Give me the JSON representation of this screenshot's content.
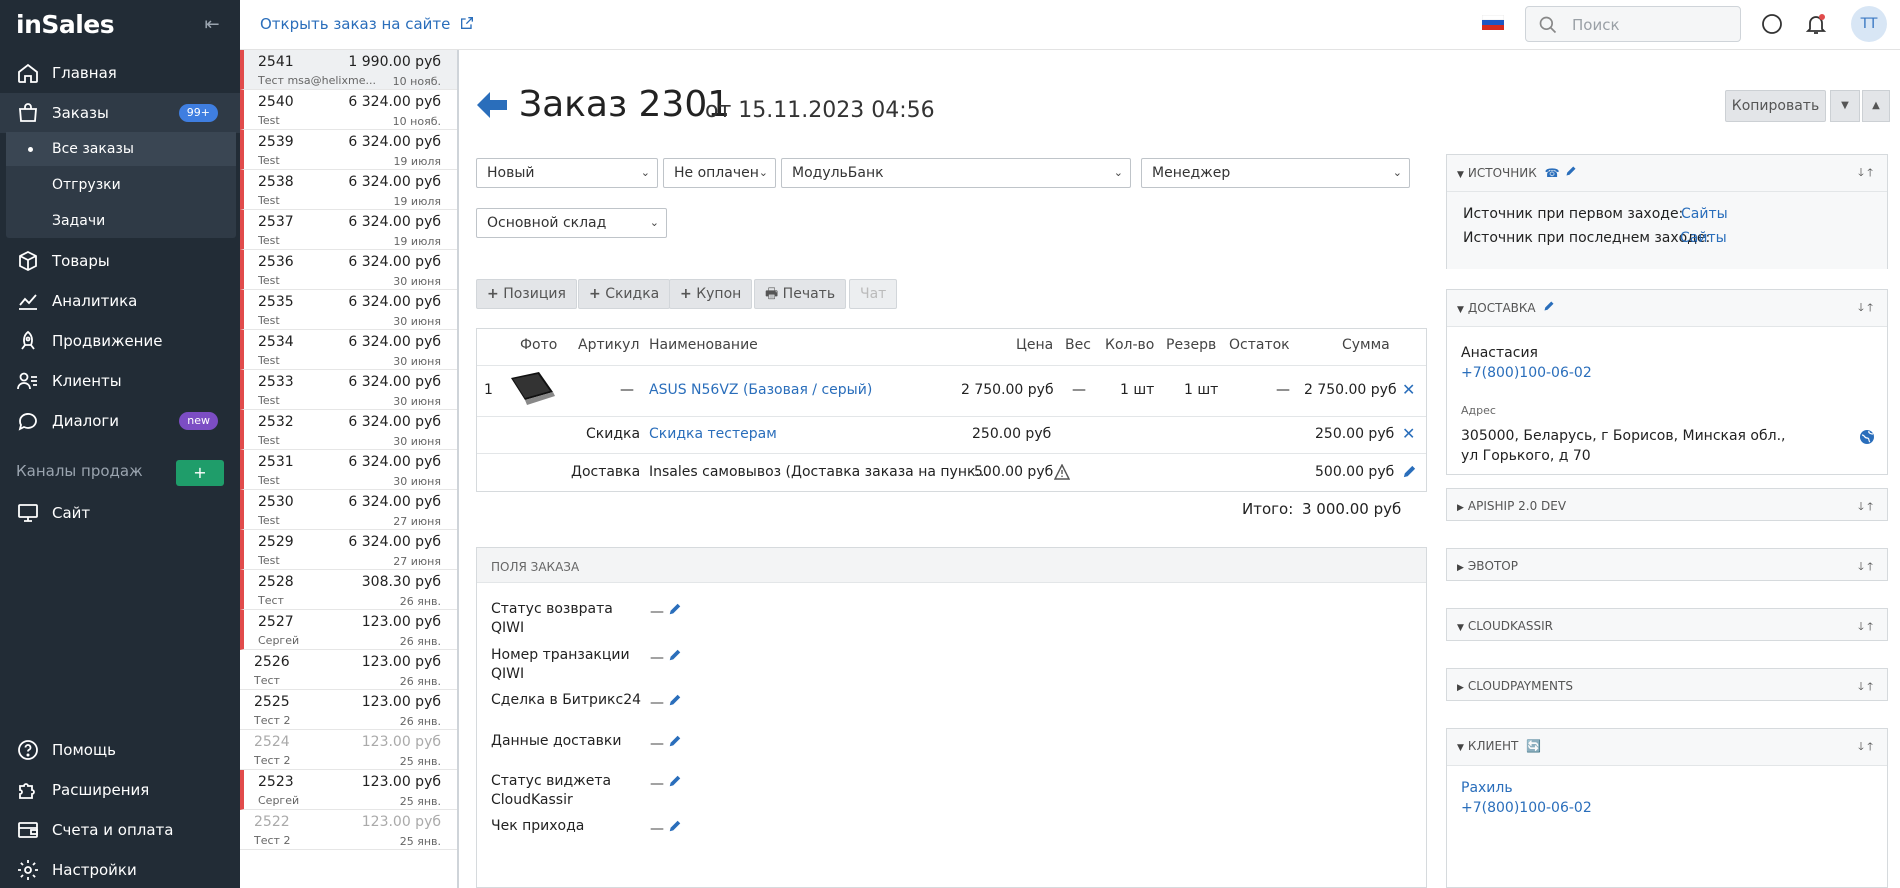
{
  "sidebar": {
    "logo": "inSales",
    "nav": [
      {
        "label": "Главная",
        "icon": "home-icon"
      },
      {
        "label": "Заказы",
        "icon": "bag-icon",
        "badge": "99+"
      },
      {
        "label": "Товары",
        "icon": "box-icon"
      },
      {
        "label": "Аналитика",
        "icon": "chart-icon"
      },
      {
        "label": "Продвижение",
        "icon": "rocket-icon"
      },
      {
        "label": "Клиенты",
        "icon": "users-icon"
      },
      {
        "label": "Диалоги",
        "icon": "chat-icon",
        "badge": "new"
      }
    ],
    "subnav": [
      "Все заказы",
      "Отгрузки",
      "Задачи"
    ],
    "channels_label": "Каналы продаж",
    "add_channel": "+",
    "site": "Сайт",
    "bottom": [
      "Помощь",
      "Расширения",
      "Счета и оплата",
      "Настройки"
    ]
  },
  "topbar": {
    "open_site": "Открыть заказ на сайте",
    "search_placeholder": "Поиск",
    "avatar": "TT"
  },
  "order_list": [
    {
      "num": "2541",
      "price": "1 990.00 руб",
      "who": "Тест msa@helixme...",
      "date": "10 нояб.",
      "red": true,
      "selected": true
    },
    {
      "num": "2540",
      "price": "6 324.00 руб",
      "who": "Test",
      "date": "10 нояб.",
      "red": true
    },
    {
      "num": "2539",
      "price": "6 324.00 руб",
      "who": "Test",
      "date": "19 июля",
      "red": true
    },
    {
      "num": "2538",
      "price": "6 324.00 руб",
      "who": "Test",
      "date": "19 июля",
      "red": true
    },
    {
      "num": "2537",
      "price": "6 324.00 руб",
      "who": "Test",
      "date": "19 июля",
      "red": true
    },
    {
      "num": "2536",
      "price": "6 324.00 руб",
      "who": "Test",
      "date": "30 июня",
      "red": true
    },
    {
      "num": "2535",
      "price": "6 324.00 руб",
      "who": "Test",
      "date": "30 июня",
      "red": true
    },
    {
      "num": "2534",
      "price": "6 324.00 руб",
      "who": "Test",
      "date": "30 июня",
      "red": true
    },
    {
      "num": "2533",
      "price": "6 324.00 руб",
      "who": "Test",
      "date": "30 июня",
      "red": true
    },
    {
      "num": "2532",
      "price": "6 324.00 руб",
      "who": "Test",
      "date": "30 июня",
      "red": true
    },
    {
      "num": "2531",
      "price": "6 324.00 руб",
      "who": "Test",
      "date": "30 июня",
      "red": true
    },
    {
      "num": "2530",
      "price": "6 324.00 руб",
      "who": "Test",
      "date": "27 июня",
      "red": true
    },
    {
      "num": "2529",
      "price": "6 324.00 руб",
      "who": "Test",
      "date": "27 июня",
      "red": true
    },
    {
      "num": "2528",
      "price": "308.30 руб",
      "who": "Тест",
      "date": "26 янв.",
      "red": true
    },
    {
      "num": "2527",
      "price": "123.00 руб",
      "who": "Сергей",
      "date": "26 янв.",
      "red": true
    },
    {
      "num": "2526",
      "price": "123.00 руб",
      "who": "Тест",
      "date": "26 янв.",
      "red": false
    },
    {
      "num": "2525",
      "price": "123.00 руб",
      "who": "Тест 2",
      "date": "26 янв.",
      "red": false
    },
    {
      "num": "2524",
      "price": "123.00 руб",
      "who": "Тест 2",
      "date": "25 янв.",
      "red": false,
      "dim": true
    },
    {
      "num": "2523",
      "price": "123.00 руб",
      "who": "Сергей",
      "date": "25 янв.",
      "red": true
    },
    {
      "num": "2522",
      "price": "123.00 руб",
      "who": "Тест 2",
      "date": "25 янв.",
      "red": false,
      "dim": true
    }
  ],
  "order": {
    "title": "Заказ 2301",
    "date": "от 15.11.2023 04:56",
    "copy": "Копировать",
    "status": "Новый",
    "payment_status": "Не оплачен",
    "payment_method": "МодульБанк",
    "manager": "Менеджер",
    "warehouse": "Основной склад",
    "actions": [
      "Позиция",
      "Скидка",
      "Купон",
      "Печать",
      "Чат"
    ]
  },
  "items_table": {
    "headers": [
      "Фото",
      "Артикул",
      "Наименование",
      "Цена",
      "Вес",
      "Кол-во",
      "Резерв",
      "Остаток",
      "Сумма"
    ],
    "product": {
      "idx": "1",
      "sku": "—",
      "name": "ASUS N56VZ (Базовая / серый)",
      "price": "2 750.00 руб",
      "weight": "—",
      "qty": "1 шт",
      "reserve": "1 шт",
      "stock": "—",
      "sum": "2 750.00 руб"
    },
    "discount": {
      "label": "Скидка",
      "name": "Скидка тестерам",
      "price": "250.00 руб",
      "sum": "250.00 руб"
    },
    "delivery": {
      "label": "Доставка",
      "name": "Insales самовывоз (Доставка заказа на пунк...",
      "price": "500.00 руб",
      "sum": "500.00 руб"
    },
    "total_label": "Итого:",
    "total_value": "3 000.00 руб"
  },
  "order_fields": {
    "header": "ПОЛЯ ЗАКАЗА",
    "fields": [
      {
        "label": "Статус возврата QIWI",
        "value": "—"
      },
      {
        "label": "Номер транзакции QIWI",
        "value": "—"
      },
      {
        "label": "Сделка в Битрикс24",
        "value": "—"
      },
      {
        "label": "Данные доставки",
        "value": "—"
      },
      {
        "label": "Статус виджета CloudKassir",
        "value": "—"
      },
      {
        "label": "Чек прихода",
        "value": "—"
      }
    ]
  },
  "panels": {
    "source": {
      "title": "Источник",
      "first_label": "Источник при первом заходе:",
      "first_value": "Сайты",
      "last_label": "Источник при последнем заходе:",
      "last_value": "Сайты"
    },
    "delivery": {
      "title": "Доставка",
      "name": "Анастасия",
      "phone": "+7(800)100-06-02",
      "address_label": "Адрес",
      "address_line1": "305000, Беларусь, г Борисов, Минская обл.,",
      "address_line2": "ул Горького, д 70"
    },
    "apiship": {
      "title": "APISHIP 2.0 DEV"
    },
    "evotor": {
      "title": "Эвотор"
    },
    "cloudkassir": {
      "title": "CLOUDKASSIR"
    },
    "cloudpayments": {
      "title": "CLOUDPAYMENTS"
    },
    "client": {
      "title": "Клиент",
      "name": "Рахиль",
      "phone": "+7(800)100-06-02"
    }
  }
}
